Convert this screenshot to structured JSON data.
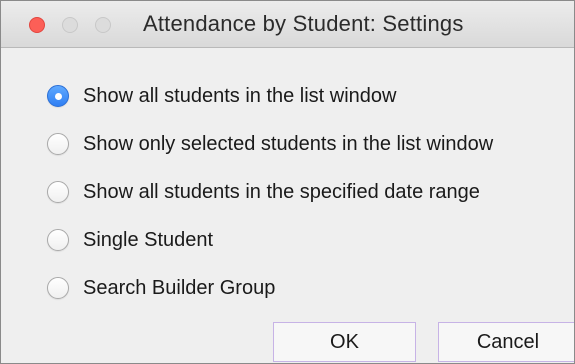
{
  "window": {
    "title": "Attendance by Student: Settings"
  },
  "options": [
    {
      "label": "Show all students in the list window",
      "checked": true
    },
    {
      "label": "Show only selected students in the list window",
      "checked": false
    },
    {
      "label": "Show all students in the specified date range",
      "checked": false
    },
    {
      "label": "Single Student",
      "checked": false
    },
    {
      "label": "Search Builder Group",
      "checked": false
    }
  ],
  "buttons": {
    "ok_label": "OK",
    "cancel_label": "Cancel"
  },
  "colors": {
    "close_button": "#fc5f57",
    "radio_selected": "#3b8bf7",
    "button_focus_border": "#c7b3e6"
  }
}
